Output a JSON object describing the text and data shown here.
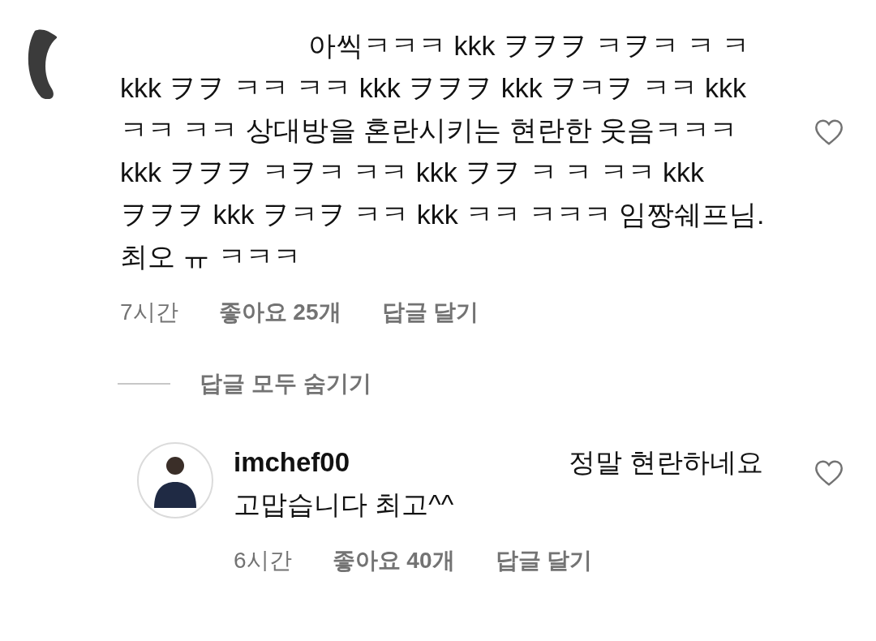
{
  "comments": [
    {
      "text": "아씩ㅋㅋㅋ kkk ヲヲヲ ㅋヲㅋ ㅋ ㅋ kkk ヲヲ ㅋㅋ ㅋㅋ kkk ヲヲヲ kkk ヲㅋヲ ㅋㅋ kkk ㅋㅋ ㅋㅋ 상대방을 혼란시키는 현란한 웃음ㅋㅋㅋ kkk ヲヲヲ ㅋヲㅋ ㅋㅋ kkk ヲヲ ㅋ ㅋ ㅋㅋ kkk ヲヲヲ kkk ヲㅋヲ ㅋㅋ kkk ㅋㅋ ㅋㅋㅋ 임짱쉐프님.최오 ㅠ ㅋㅋㅋ",
      "time": "7시간",
      "likes": "좋아요 25개",
      "reply": "답글 달기"
    }
  ],
  "hide_replies": "답글 모두 숨기기",
  "replies": [
    {
      "username": "imchef00",
      "text": "정말 현란하네요 고맙습니다 최고^^",
      "time": "6시간",
      "likes": "좋아요 40개",
      "reply": "답글 달기"
    }
  ]
}
